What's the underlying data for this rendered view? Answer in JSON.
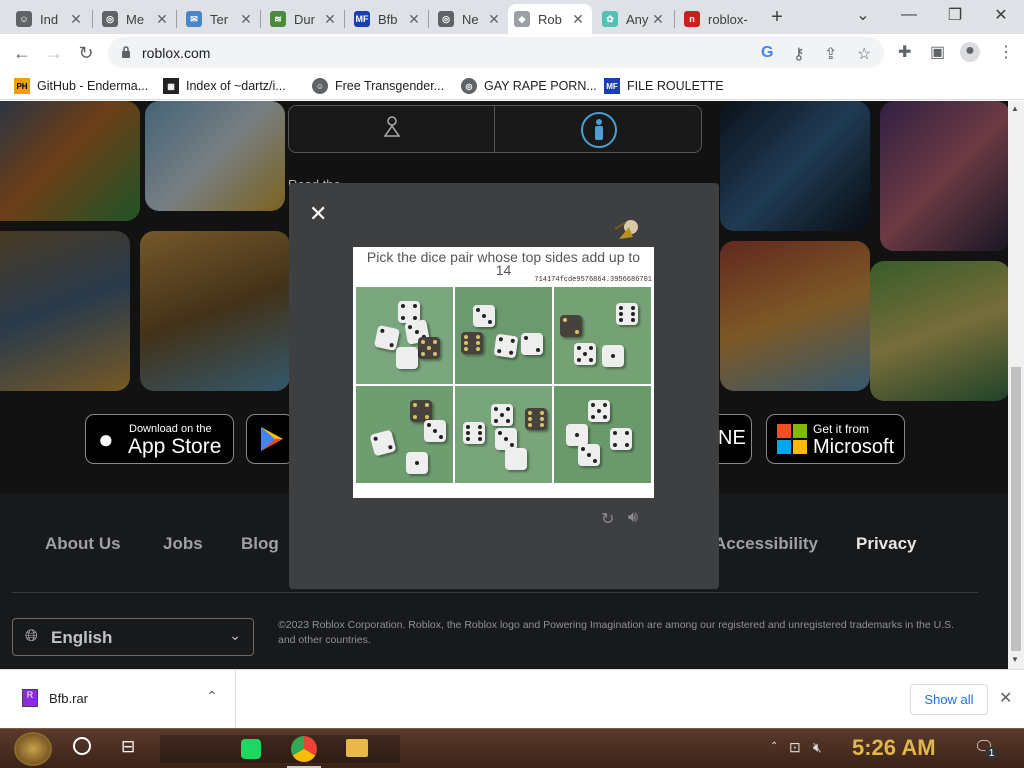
{
  "browser": {
    "tabs": [
      {
        "title": "Ind",
        "favicon_color": "#5f6368",
        "favicon_glyph": "☺"
      },
      {
        "title": "Me",
        "favicon_color": "#5f6368",
        "favicon_glyph": "◎"
      },
      {
        "title": "Ter",
        "favicon_color": "#4a86c5",
        "favicon_glyph": "✉"
      },
      {
        "title": "Dur",
        "favicon_color": "#4b8b3b",
        "favicon_glyph": "≋"
      },
      {
        "title": "Bfb",
        "favicon_color": "#1a3fb0",
        "favicon_glyph": "MF"
      },
      {
        "title": "Ne",
        "favicon_color": "#5f6368",
        "favicon_glyph": "◎"
      },
      {
        "title": "Rob",
        "favicon_color": "#9aa0a6",
        "favicon_glyph": "◆",
        "active": true
      },
      {
        "title": "Any",
        "favicon_color": "#52c2b5",
        "favicon_glyph": "✿"
      },
      {
        "title": "roblox-",
        "favicon_color": "#c5221f",
        "favicon_glyph": "n",
        "no_close": true
      }
    ],
    "new_tab_label": "+",
    "url": "roblox.com",
    "bookmarks": [
      {
        "label": "GitHub - Enderma...",
        "icon": "PH",
        "color": "#f29f05"
      },
      {
        "label": "Index of ~dartz/i...",
        "icon": "▦",
        "color": "#222222"
      },
      {
        "label": "Free Transgender...",
        "icon": "☺",
        "color": "#5f6368"
      },
      {
        "label": "GAY RAPE PORN...",
        "icon": "◎",
        "color": "#5f6368"
      },
      {
        "label": "FILE ROULETTE",
        "icon": "MF",
        "color": "#1a3fb0"
      }
    ]
  },
  "page": {
    "background_text": "Read the ",
    "store_badges": {
      "appstore_small": "Download on the",
      "appstore_big": "App Store",
      "microsoft_small": "Get it from",
      "microsoft_big": "Microsoft",
      "xbox_partial": "NE"
    },
    "footer_links": [
      "About Us",
      "Jobs",
      "Blog",
      "Accessibility",
      "Privacy"
    ],
    "language": "English",
    "copyright": "©2023 Roblox Corporation. Roblox, the Roblox logo and Powering Imagination are among our registered and unregistered trademarks in the U.S. and other countries."
  },
  "captcha": {
    "close_label": "✕",
    "prompt": "Pick the dice pair whose top sides add up to 14",
    "challenge_code": "714174fcde9576864.3956686701",
    "refresh_icon": "refresh-icon",
    "audio_icon": "audio-icon",
    "cells": [
      {
        "id": 1,
        "dice": [
          "4",
          "3",
          "2",
          "5"
        ]
      },
      {
        "id": 2,
        "dice": [
          "3",
          "6",
          "4",
          "2"
        ]
      },
      {
        "id": 3,
        "dice": [
          "6",
          "2",
          "5",
          "1"
        ]
      },
      {
        "id": 4,
        "dice": [
          "4",
          "3",
          "2",
          "1"
        ]
      },
      {
        "id": 5,
        "dice": [
          "5",
          "6",
          "6",
          "3"
        ]
      },
      {
        "id": 6,
        "dice": [
          "5",
          "1",
          "4",
          "3"
        ]
      }
    ]
  },
  "downloads": {
    "file_name": "Bfb.rar",
    "show_all": "Show all"
  },
  "taskbar": {
    "clock": "5:26 AM",
    "notification_count": "1"
  }
}
